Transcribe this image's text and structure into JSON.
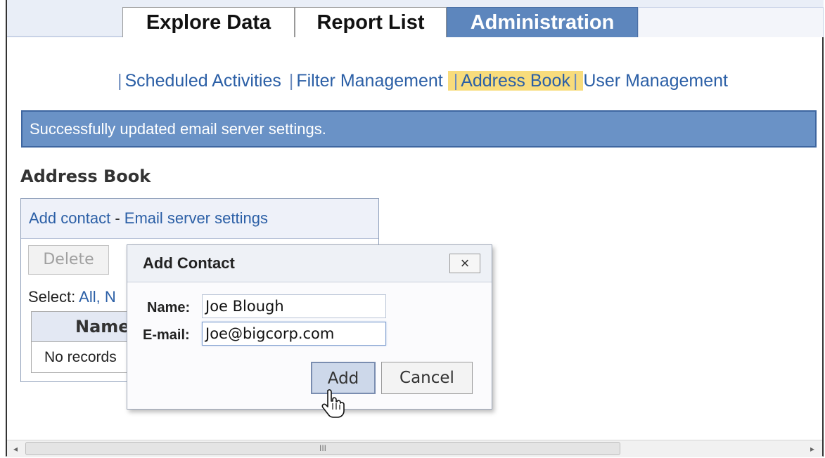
{
  "tabs": [
    {
      "label": "Explore Data",
      "active": false
    },
    {
      "label": "Report List",
      "active": false
    },
    {
      "label": "Administration",
      "active": true
    }
  ],
  "subnav": {
    "items": [
      "Scheduled Activities",
      "Filter Management",
      "Address Book",
      "User Management"
    ],
    "separator": "|",
    "active": "Address Book"
  },
  "banner": {
    "message": "Successfully updated email server settings."
  },
  "address_book": {
    "title": "Address Book",
    "add_contact": "Add contact",
    "dash": "-",
    "email_server_settings": "Email server settings",
    "delete_label": "Delete",
    "select_label": "Select:",
    "select_all": "All,",
    "select_none_partial": "N",
    "column_name": "Name",
    "empty_text": "No records"
  },
  "dialog": {
    "title": "Add Contact",
    "close": "×",
    "name_label": "Name:",
    "name_value": "Joe Blough",
    "email_label": "E-mail:",
    "email_value": "Joe@bigcorp.com",
    "add_label": "Add",
    "cancel_label": "Cancel"
  },
  "scrollbar": {
    "left_arrow": "◂",
    "right_arrow": "▸",
    "grip": "III"
  },
  "colors": {
    "active_tab": "#5d86bd",
    "banner": "#6a92c6",
    "highlight": "#f8dc7c",
    "link": "#2b5fa6"
  }
}
